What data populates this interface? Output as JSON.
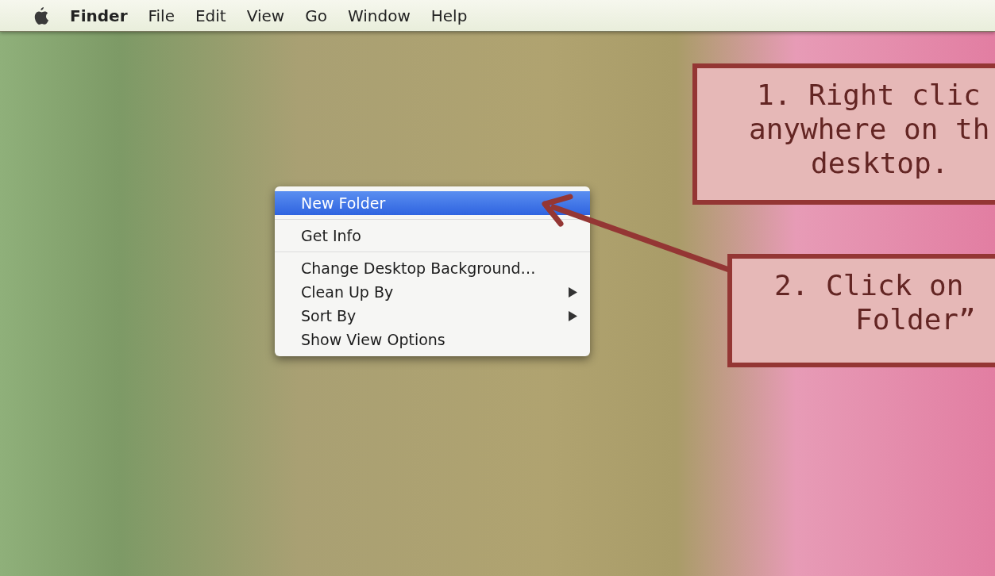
{
  "menu_bar": {
    "app_name": "Finder",
    "items": [
      "File",
      "Edit",
      "View",
      "Go",
      "Window",
      "Help"
    ]
  },
  "context_menu": {
    "sections": [
      [
        {
          "label": "New Folder",
          "selected": true,
          "submenu": false
        }
      ],
      [
        {
          "label": "Get Info",
          "selected": false,
          "submenu": false
        }
      ],
      [
        {
          "label": "Change Desktop Background…",
          "selected": false,
          "submenu": false
        },
        {
          "label": "Clean Up By",
          "selected": false,
          "submenu": true
        },
        {
          "label": "Sort By",
          "selected": false,
          "submenu": true
        },
        {
          "label": "Show View Options",
          "selected": false,
          "submenu": false
        }
      ]
    ]
  },
  "callouts": [
    {
      "lines": [
        "1. Right clic",
        "anywhere on th",
        "desktop."
      ]
    },
    {
      "lines": [
        "2. Click on",
        "Folder”"
      ]
    }
  ]
}
